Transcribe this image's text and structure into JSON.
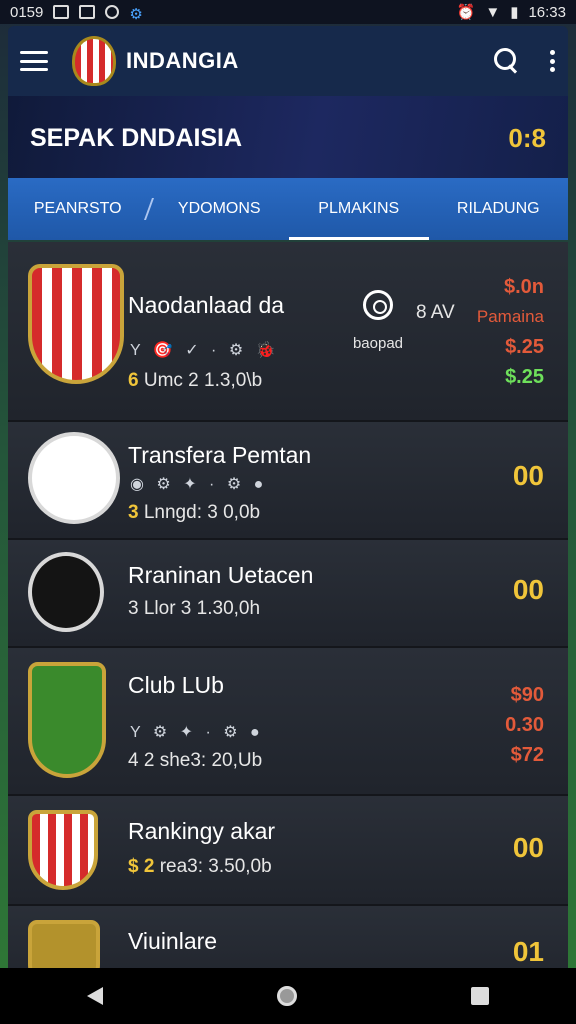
{
  "status": {
    "time_left": "0159",
    "time_right": "16:33"
  },
  "app": {
    "title": "INDANGIA"
  },
  "banner": {
    "title": "SEPAK DNDAISIA",
    "score": "0:8"
  },
  "tabs": [
    "PEANRSTO",
    "YDOMONS",
    "PLMAKINS",
    "RILADUNG"
  ],
  "rows": [
    {
      "name": "Naodanlaad da",
      "icons": "Y 🎯 ✓ · ⚙ 🐞",
      "stats_hl": "6",
      "stats": "Umc 2  1.3,0\\b",
      "mid_label": "baopad",
      "mid_extra": "8 AV",
      "right": [
        "$.0n",
        "Pamaina",
        "$.25",
        "$.25"
      ]
    },
    {
      "name": "Transfera Pemtan",
      "icons": "◉ ⚙ ✦ · ⚙ ●",
      "stats_hl": "3",
      "stats": "Lnngd: 3 0,0b",
      "score": "00"
    },
    {
      "name": "Rraninan Uetacen",
      "icons": "",
      "stats_hl": "",
      "stats": "3 Llor 3  1.30,0h",
      "score": "00"
    },
    {
      "name": "Club LUb",
      "icons": "Y ⚙ ✦ · ⚙ ●",
      "stats_hl": "",
      "stats": "4 2 she3: 20,Ub",
      "right": [
        "$90",
        "0.30",
        "$72"
      ]
    },
    {
      "name": "Rankingy akar",
      "icons": "",
      "stats_hl": "$ 2",
      "stats": "rea3: 3.50,0b",
      "score": "00"
    },
    {
      "name": "Viuinlare",
      "icons": "",
      "stats_hl": "",
      "stats": "",
      "score": "01"
    }
  ],
  "colors": {
    "accent": "#f0c53a",
    "tab_bar": "#2a6bc4",
    "app_bar": "#16294b",
    "negative": "#e35a3a",
    "positive": "#6ee05b"
  }
}
